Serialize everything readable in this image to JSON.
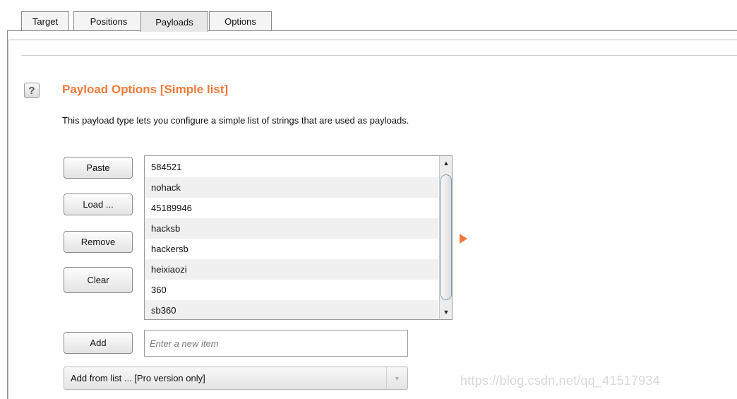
{
  "tabs": [
    {
      "label": "Target",
      "active": false
    },
    {
      "label": "Positions",
      "active": false
    },
    {
      "label": "Payloads",
      "active": true
    },
    {
      "label": "Options",
      "active": false
    }
  ],
  "section": {
    "help_icon": "?",
    "title": "Payload Options [Simple list]",
    "description": "This payload type lets you configure a simple list of strings that are used as payloads."
  },
  "buttons": {
    "paste": "Paste",
    "load": "Load ...",
    "remove": "Remove",
    "clear": "Clear",
    "add": "Add"
  },
  "payload_list": {
    "items": [
      "584521",
      "nohack",
      "45189946",
      "hacksb",
      "hackersb",
      "heixiaozi",
      "360",
      "sb360"
    ],
    "scroll_up_icon": "▲",
    "scroll_down_icon": "▼"
  },
  "new_item": {
    "placeholder": "Enter a new item",
    "value": ""
  },
  "add_from_list": {
    "selected": "Add from list ... [Pro version only]",
    "arrow_icon": "▼"
  },
  "colors": {
    "accent": "#f07a3a"
  },
  "watermark": "https://blog.csdn.net/qq_41517934"
}
